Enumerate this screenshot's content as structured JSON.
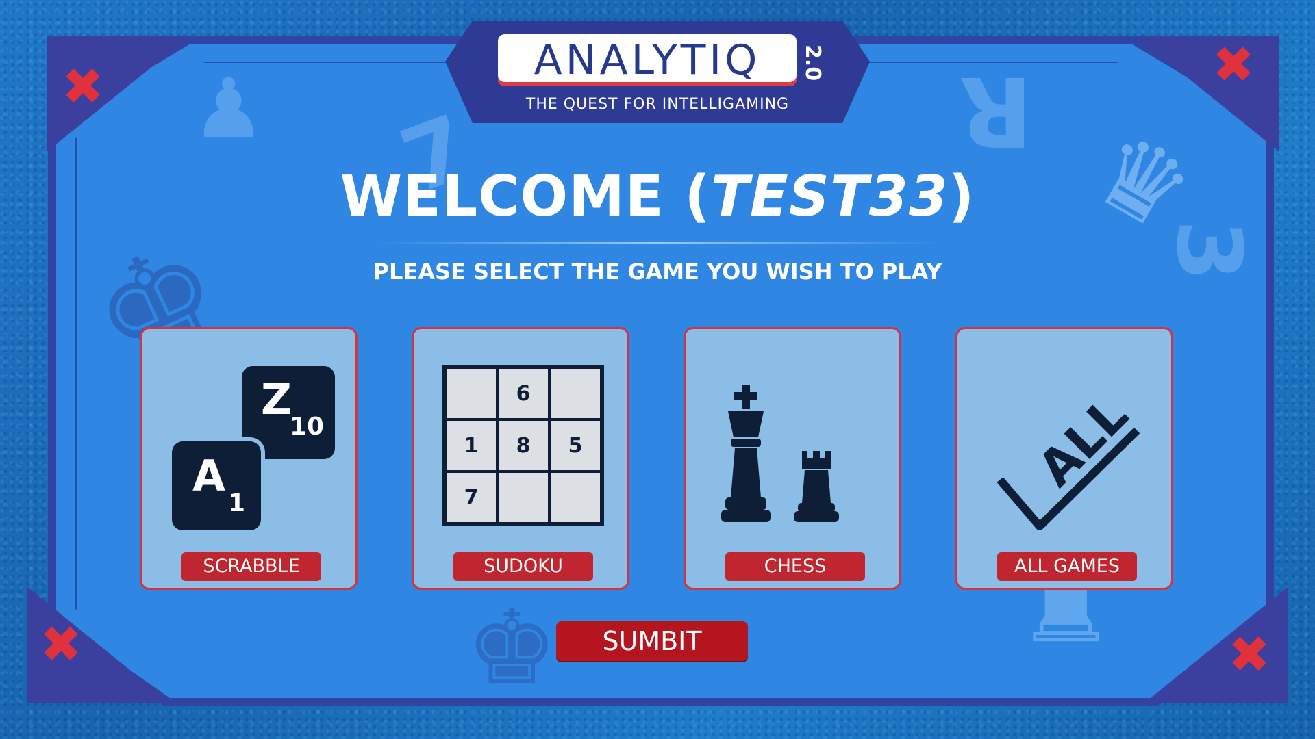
{
  "logo": {
    "text": "ANALYTIQ",
    "version": "2.0",
    "tagline": "THE QUEST FOR INTELLIGAMING"
  },
  "welcome": {
    "prefix": "WELCOME (",
    "username": "TEST33",
    "suffix": ")"
  },
  "subtitle": "PLEASE SELECT THE GAME YOU WISH TO PLAY",
  "games": [
    {
      "label": "SCRABBLE",
      "tiles": [
        {
          "letter": "Z",
          "score": "10"
        },
        {
          "letter": "A",
          "score": "1"
        }
      ]
    },
    {
      "label": "SUDOKU",
      "grid": [
        "",
        "6",
        "",
        "1",
        "8",
        "5",
        "7",
        "",
        ""
      ]
    },
    {
      "label": "CHESS"
    },
    {
      "label": "ALL GAMES",
      "icon_text": "ALL"
    }
  ],
  "submit_label": "SUMBIT",
  "colors": {
    "accent_red": "#c0262f",
    "frame": "#3144a3",
    "card_bg": "#8bbde6",
    "tile_dark": "#0d1e36"
  }
}
